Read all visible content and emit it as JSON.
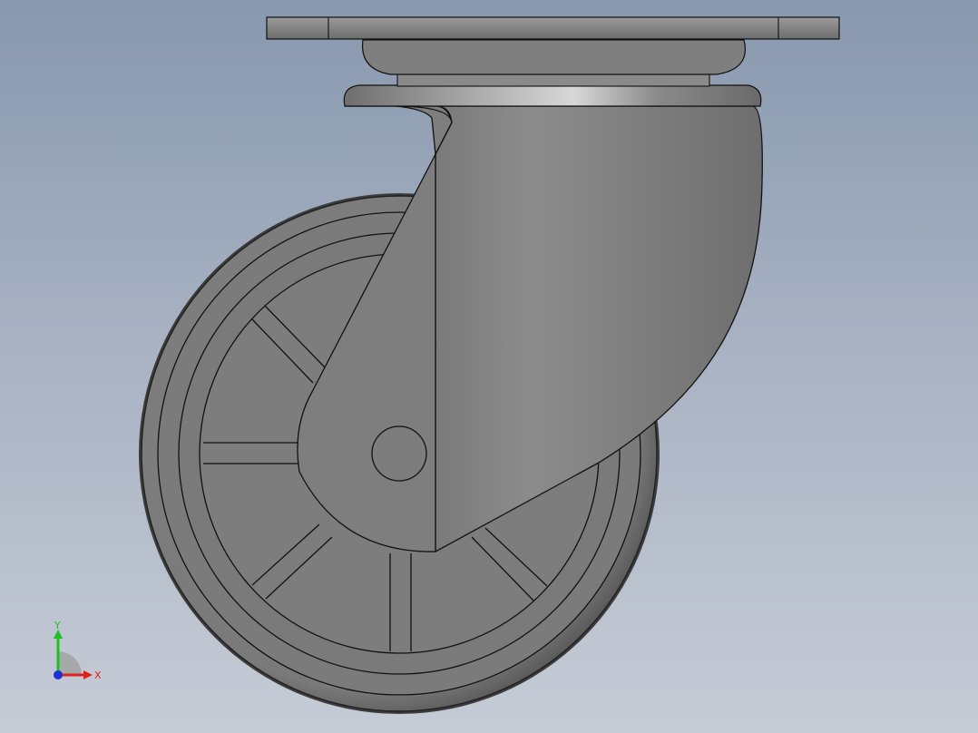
{
  "viewport": {
    "background_top": "#8898ae",
    "background_bottom": "#c6ccd6"
  },
  "model": {
    "body_color": "#7f7f7f",
    "edge_color": "#1a1a1a"
  },
  "triad": {
    "x_label": "X",
    "y_label": "Y",
    "x_color": "#e02020",
    "y_color": "#20c020",
    "z_color": "#2030d0"
  }
}
